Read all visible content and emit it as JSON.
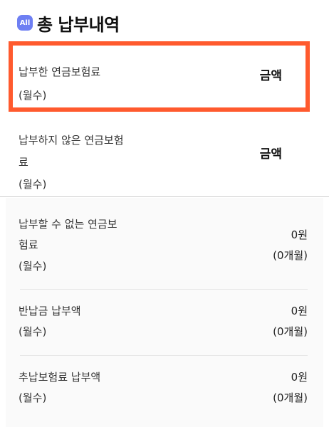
{
  "header": {
    "badge": "All",
    "title": "총 납부내역"
  },
  "items": [
    {
      "label_line1": "납부한 연금보험료",
      "unit": "(월수)",
      "amount": "금액"
    },
    {
      "label_line1": "납부하지 않은 연금보험",
      "label_line2": "료",
      "unit": "(월수)",
      "amount": "금액"
    }
  ],
  "panel_items": [
    {
      "label_line1": "납부할 수 없는 연금보",
      "label_line2": "험료",
      "unit": "(월수)",
      "amount": "0원",
      "months": "(0개월)"
    },
    {
      "label_line1": "반납금 납부액",
      "unit": "(월수)",
      "amount": "0원",
      "months": "(0개월)"
    },
    {
      "label_line1": "추납보험료 납부액",
      "unit": "(월수)",
      "amount": "0원",
      "months": "(0개월)"
    }
  ],
  "colors": {
    "highlight": "#ff5a2e",
    "badge": "#6e7ff3"
  }
}
